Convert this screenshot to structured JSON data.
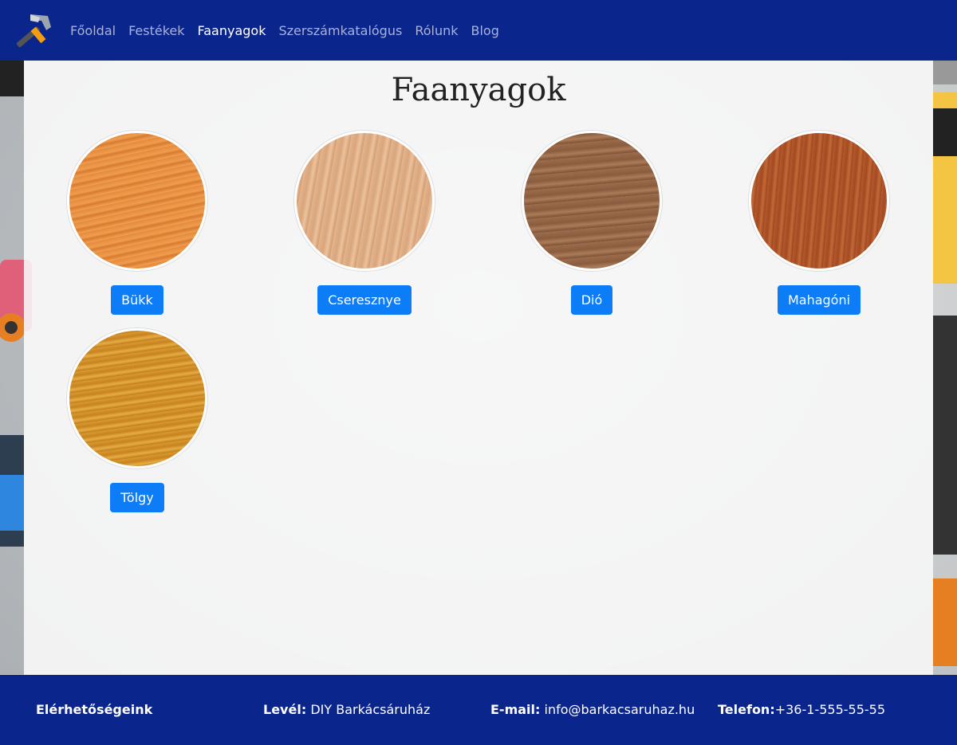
{
  "nav": {
    "links": [
      {
        "label": "Főoldal"
      },
      {
        "label": "Festékek"
      },
      {
        "label": "Faanyagok"
      },
      {
        "label": "Szerszámkatalógus"
      },
      {
        "label": "Rólunk"
      },
      {
        "label": "Blog"
      }
    ],
    "active_index": 2
  },
  "main": {
    "title": "Faanyagok",
    "woods": [
      {
        "label": "Bükk",
        "color": "#e68a3c"
      },
      {
        "label": "Cseresznye",
        "color": "#e0b088"
      },
      {
        "label": "Dió",
        "color": "#9a6b4a"
      },
      {
        "label": "Mahagóni",
        "color": "#b4562b"
      },
      {
        "label": "Tölgy",
        "color": "#d8952e"
      }
    ]
  },
  "footer": {
    "heading": "Elérhetőségeink",
    "mail_label": "Levél:",
    "mail_value": "DIY Barkácsáruház",
    "email_label": "E-mail:",
    "email_value": "info@barkacsaruhaz.hu",
    "phone_label": "Telefon:",
    "phone_value": "+36-1-555-55-55"
  },
  "colors": {
    "navbar": "#0a258c",
    "button": "#0d7cf7"
  }
}
